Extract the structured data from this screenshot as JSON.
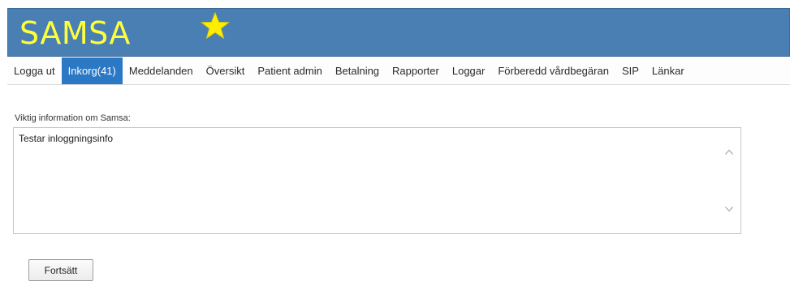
{
  "app": {
    "title": "SAMSA"
  },
  "nav": {
    "items": [
      {
        "label": "Logga ut"
      },
      {
        "label": "Inkorg(41)",
        "active": true
      },
      {
        "label": "Meddelanden"
      },
      {
        "label": "Översikt"
      },
      {
        "label": "Patient admin"
      },
      {
        "label": "Betalning"
      },
      {
        "label": "Rapporter"
      },
      {
        "label": "Loggar"
      },
      {
        "label": "Förberedd vårdbegäran"
      },
      {
        "label": "SIP"
      },
      {
        "label": "Länkar"
      }
    ]
  },
  "info": {
    "label": "Viktig information om Samsa:",
    "text": "Testar inloggningsinfo"
  },
  "actions": {
    "continue_label": "Fortsätt"
  },
  "colors": {
    "header_bg": "#4a7fb3",
    "logo": "#ffff3a",
    "star": "#ffee00",
    "active_tab": "#2b78c4"
  },
  "icons": {
    "logo_star": "star-icon",
    "scroll_up": "chevron-up-icon",
    "scroll_down": "chevron-down-icon"
  }
}
